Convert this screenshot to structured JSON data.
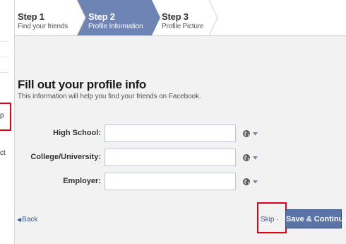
{
  "left_column": {
    "fragments": [
      "p",
      "ct"
    ]
  },
  "steps": [
    {
      "number": "Step 1",
      "label": "Find your friends",
      "state": "done"
    },
    {
      "number": "Step 2",
      "label": "Profile Information",
      "state": "active"
    },
    {
      "number": "Step 3",
      "label": "Profile Picture",
      "state": "upcoming"
    }
  ],
  "form": {
    "title": "Fill out your profile info",
    "subtitle": "This information will help you find your friends on Facebook.",
    "fields": [
      {
        "label": "High School:",
        "value": ""
      },
      {
        "label": "College/University:",
        "value": ""
      },
      {
        "label": "Employer:",
        "value": ""
      }
    ]
  },
  "actions": {
    "back_label": "Back",
    "back_arrow": "◀",
    "skip_label": "Skip",
    "save_label": "Save & Continue"
  },
  "colors": {
    "active_step": "#6d84b4",
    "button": "#5b74a8",
    "link": "#3b5998",
    "highlight": "#e0001b",
    "card_background": "#f2f2f2"
  },
  "icons": {
    "privacy": "globe-icon",
    "privacy_menu": "caret-down-icon",
    "back": "back-arrow-icon"
  }
}
